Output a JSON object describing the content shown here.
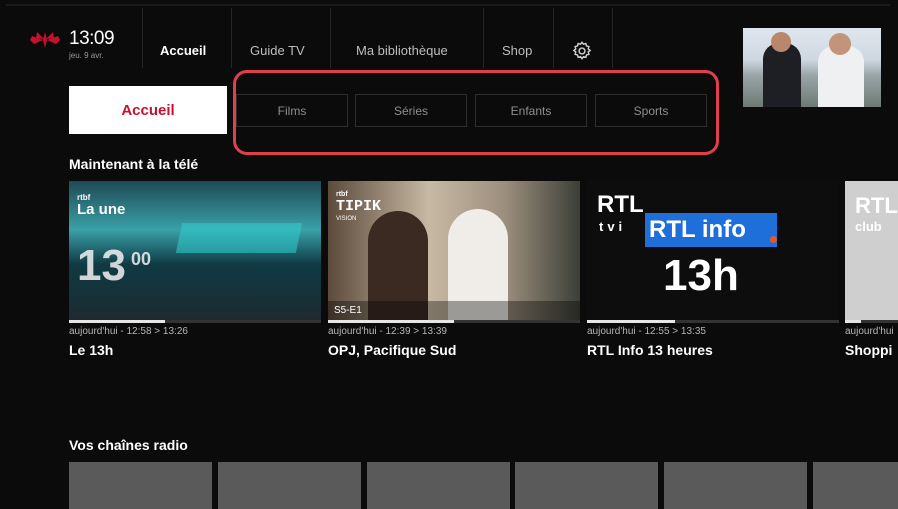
{
  "header": {
    "time": "13:09",
    "date": "jeu. 9 avr.",
    "nav": [
      {
        "label": "Accueil",
        "active": true
      },
      {
        "label": "Guide TV",
        "active": false
      },
      {
        "label": "Ma bibliothèque",
        "active": false
      },
      {
        "label": "Shop",
        "active": false
      }
    ],
    "settings_icon": "gear-icon",
    "brand_color": "#c8102e"
  },
  "tabs": [
    {
      "label": "Accueil",
      "selected": true
    },
    {
      "label": "Films",
      "selected": false
    },
    {
      "label": "Séries",
      "selected": false
    },
    {
      "label": "Enfants",
      "selected": false
    },
    {
      "label": "Sports",
      "selected": false
    }
  ],
  "highlight_color": "#e0404b",
  "now_on_tv": {
    "title": "Maintenant à la télé",
    "items": [
      {
        "channel": "rtbf",
        "channel_sub": "La une",
        "overlay": "13",
        "overlay_small": "00",
        "time": "aujourd'hui - 12:58 > 13:26",
        "title": "Le 13h",
        "progress": 0.38
      },
      {
        "channel": "rtbf",
        "channel_sub": "TIPIK",
        "channel_sub2": "VISION",
        "badge": "S5-E1",
        "time": "aujourd'hui - 12:39 > 13:39",
        "title": "OPJ, Pacifique Sud",
        "progress": 0.5
      },
      {
        "channel": "RTL",
        "channel_sub": "tvi",
        "overlay": "RTL info",
        "overlay_big": "13h",
        "time": "aujourd'hui - 12:55 > 13:35",
        "title": "RTL Info 13 heures",
        "progress": 0.35
      },
      {
        "channel": "RTL",
        "channel_sub": "club",
        "time": "aujourd'hui",
        "title": "Shoppi",
        "progress": 0.3
      }
    ]
  },
  "radio": {
    "title": "Vos chaînes radio",
    "tile_count": 6
  }
}
